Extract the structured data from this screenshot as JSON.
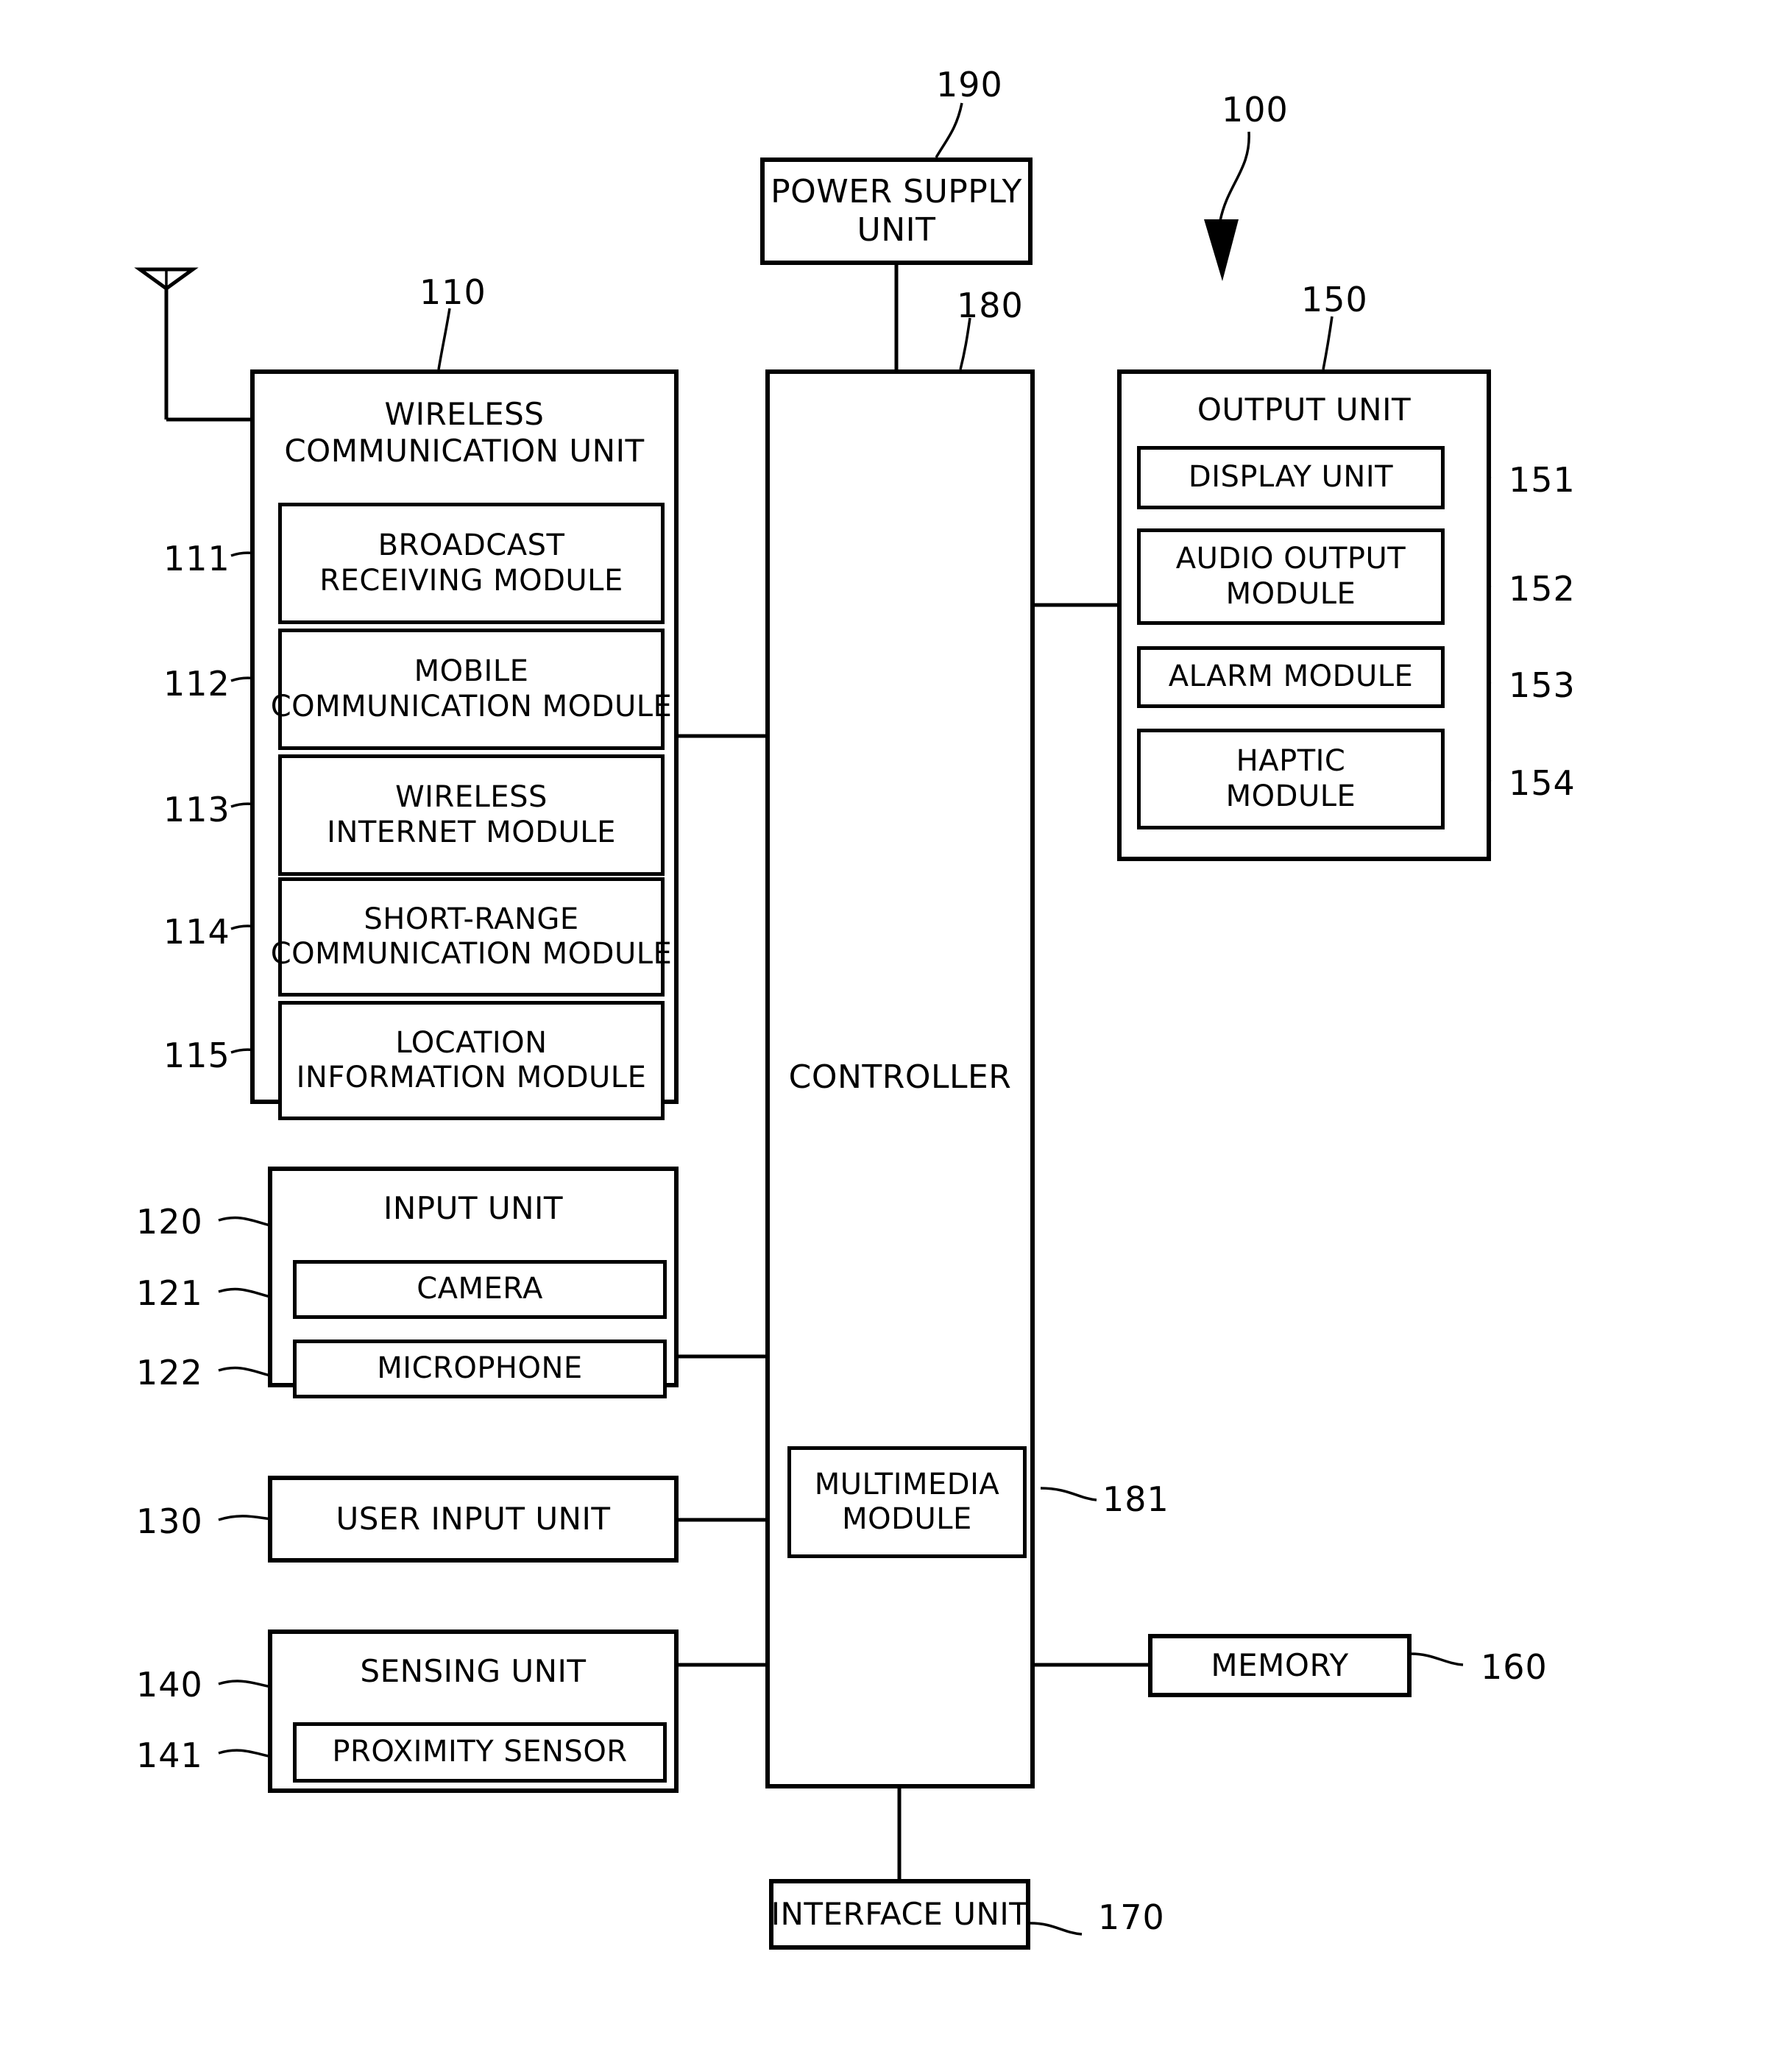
{
  "figure": {
    "device_ref": "100",
    "antenna": "antenna-symbol"
  },
  "power_supply": {
    "ref": "190",
    "label": "POWER SUPPLY\nUNIT"
  },
  "controller": {
    "ref": "180",
    "label": "CONTROLLER",
    "multimedia": {
      "ref": "181",
      "label": "MULTIMEDIA\nMODULE"
    }
  },
  "wireless_communication_unit": {
    "ref": "110",
    "label": "WIRELESS\nCOMMUNICATION UNIT",
    "modules": [
      {
        "ref": "111",
        "label": "BROADCAST\nRECEIVING MODULE"
      },
      {
        "ref": "112",
        "label": "MOBILE\nCOMMUNICATION MODULE"
      },
      {
        "ref": "113",
        "label": "WIRELESS\nINTERNET MODULE"
      },
      {
        "ref": "114",
        "label": "SHORT-RANGE\nCOMMUNICATION MODULE"
      },
      {
        "ref": "115",
        "label": "LOCATION\nINFORMATION MODULE"
      }
    ]
  },
  "input_unit": {
    "ref": "120",
    "label": "INPUT UNIT",
    "modules": [
      {
        "ref": "121",
        "label": "CAMERA"
      },
      {
        "ref": "122",
        "label": "MICROPHONE"
      }
    ]
  },
  "user_input_unit": {
    "ref": "130",
    "label": "USER INPUT UNIT"
  },
  "sensing_unit": {
    "ref": "140",
    "label": "SENSING UNIT",
    "modules": [
      {
        "ref": "141",
        "label": "PROXIMITY SENSOR"
      }
    ]
  },
  "output_unit": {
    "ref": "150",
    "label": "OUTPUT UNIT",
    "modules": [
      {
        "ref": "151",
        "label": "DISPLAY UNIT"
      },
      {
        "ref": "152",
        "label": "AUDIO OUTPUT\nMODULE"
      },
      {
        "ref": "153",
        "label": "ALARM MODULE"
      },
      {
        "ref": "154",
        "label": "HAPTIC\nMODULE"
      }
    ]
  },
  "memory": {
    "ref": "160",
    "label": "MEMORY"
  },
  "interface_unit": {
    "ref": "170",
    "label": "INTERFACE UNIT"
  },
  "colors": {
    "ink": "#000000",
    "paper": "#ffffff"
  }
}
